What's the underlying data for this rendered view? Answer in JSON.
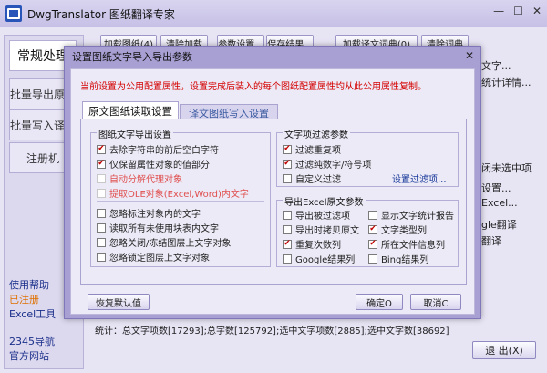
{
  "app": {
    "title": "DwgTranslator 图纸翻译专家",
    "controls": {
      "minimize": "—",
      "maximize": "☐",
      "close": "✕"
    }
  },
  "toolbar": {
    "load_drawings": "加载图纸(4)",
    "clear_loaded": "清除加载",
    "param_settings": "参数设置...",
    "save_results": "保存结果...",
    "load_translation_dict": "加载译文词典(0)",
    "clear_dict": "清除词典"
  },
  "left_tabs": [
    "常规处理",
    "批量导出原文",
    "批量写入译文",
    "注册机"
  ],
  "left_links": {
    "help": "使用帮助",
    "registered": "已注册",
    "excel_tool": "Excel工具",
    "nav2345": "2345导航",
    "official_site": "官方网站"
  },
  "right_items": [
    "文字...",
    "统计详情...",
    "闭未选中项",
    "设置...",
    "Excel...",
    "gle翻译",
    "翻译"
  ],
  "status": "统计：总文字项数[17293];总字数[125792];选中文字项数[2885];选中文字数[38692]",
  "exit_button": "退 出(X)",
  "dialog": {
    "title": "设置图纸文字导入导出参数",
    "close": "✕",
    "notice": "当前设置为公用配置属性，设置完成后装入的每个图纸配置属性均从此公用属性复制。",
    "tabs": [
      "原文图纸读取设置",
      "译文图纸写入设置"
    ],
    "export_group": {
      "title": "图纸文字导出设置",
      "options": [
        {
          "label": "去除字符串的前后空白字符",
          "checked": true,
          "enabled": true
        },
        {
          "label": "仅保留属性对象的值部分",
          "checked": true,
          "enabled": true
        },
        {
          "label": "自动分解代理对象",
          "checked": false,
          "enabled": false
        },
        {
          "label": "提取OLE对象(Excel,Word)内文字",
          "checked": false,
          "enabled": false
        },
        {
          "label": "忽略标注对象内的文字",
          "checked": false,
          "enabled": true
        },
        {
          "label": "读取所有未使用块表内文字",
          "checked": false,
          "enabled": true
        },
        {
          "label": "忽略关闭/冻结图层上文字对象",
          "checked": false,
          "enabled": true
        },
        {
          "label": "忽略锁定图层上文字对象",
          "checked": false,
          "enabled": true
        }
      ]
    },
    "filter_group": {
      "title": "文字项过滤参数",
      "options": [
        {
          "label": "过滤重复项",
          "checked": true
        },
        {
          "label": "过滤纯数字/符号项",
          "checked": true
        },
        {
          "label": "自定义过滤",
          "checked": false
        }
      ],
      "link": "设置过滤项..."
    },
    "excel_group": {
      "title": "导出Excel原文参数",
      "options": [
        {
          "label": "导出被过滤项",
          "checked": false
        },
        {
          "label": "显示文字统计报告",
          "checked": false
        },
        {
          "label": "导出时拷贝原文",
          "checked": false
        },
        {
          "label": "文字类型列",
          "checked": true
        },
        {
          "label": "重复次数列",
          "checked": true
        },
        {
          "label": "所在文件信息列",
          "checked": true
        },
        {
          "label": "Google结果列",
          "checked": false
        },
        {
          "label": "Bing结果列",
          "checked": false
        }
      ]
    },
    "buttons": {
      "restore_defaults": "恢复默认值",
      "ok": "确定O",
      "cancel": "取消C"
    }
  }
}
